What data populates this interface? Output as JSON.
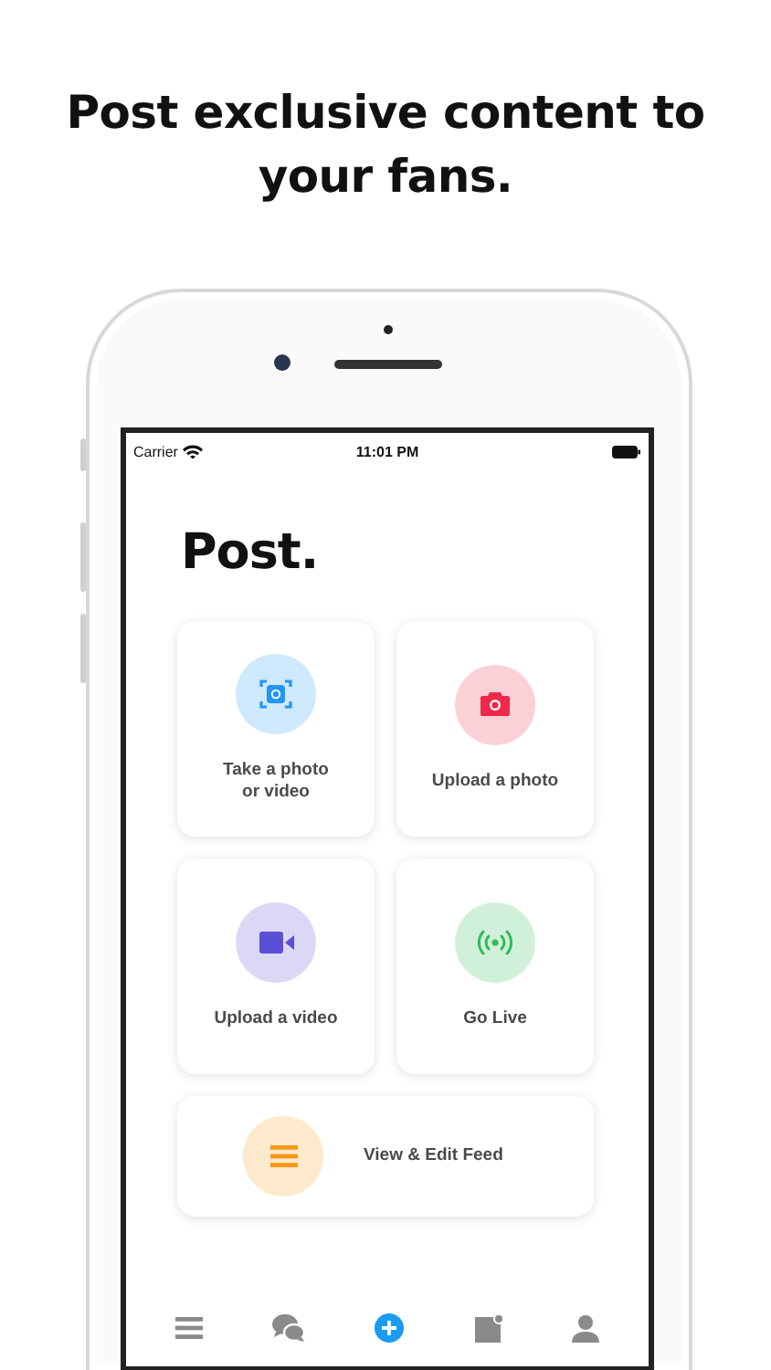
{
  "headline": "Post exclusive content to your fans.",
  "status_bar": {
    "carrier": "Carrier",
    "time": "11:01 PM"
  },
  "title": "Post.",
  "tiles": [
    {
      "kind": "camera-frame",
      "label": "Take a photo or video",
      "color": "#2196f3"
    },
    {
      "kind": "camera",
      "label": "Upload a photo",
      "color": "#f0284a"
    },
    {
      "kind": "video",
      "label": "Upload a video",
      "color": "#5a4fd6"
    },
    {
      "kind": "live",
      "label": "Go Live",
      "color": "#2ebd59"
    }
  ],
  "wide_tile": {
    "kind": "menu",
    "label": "View & Edit Feed",
    "color": "#f59a14"
  },
  "tabs": [
    {
      "kind": "menu",
      "selected": false
    },
    {
      "kind": "chat",
      "selected": false
    },
    {
      "kind": "plus",
      "selected": true
    },
    {
      "kind": "note",
      "selected": false
    },
    {
      "kind": "person",
      "selected": false
    }
  ]
}
